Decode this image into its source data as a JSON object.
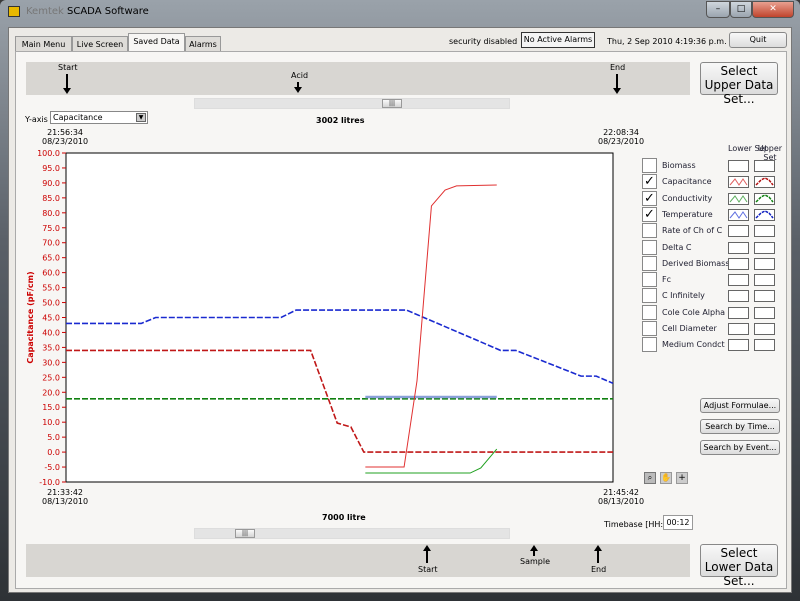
{
  "window": {
    "title": "SCADA Software",
    "title_blurred": "Kemtek",
    "minimize": "–",
    "maximize": "□",
    "close": "✕"
  },
  "tabs": [
    {
      "label": "Main Menu"
    },
    {
      "label": "Live Screen"
    },
    {
      "label": "Saved Data",
      "active": true
    },
    {
      "label": "Alarms"
    }
  ],
  "status": {
    "security": "security disabled",
    "alarms": "No Active Alarms",
    "datetime": "Thu, 2 Sep 2010  4:19:36 p.m.",
    "quit": "Quit"
  },
  "upper_events": {
    "markers": [
      {
        "label": "Start"
      },
      {
        "label": "Acid"
      },
      {
        "label": "End"
      }
    ],
    "select_button": "Select Upper Data Set..."
  },
  "lower_events": {
    "markers": [
      {
        "label": "Start"
      },
      {
        "label": "Sample"
      },
      {
        "label": "End"
      }
    ],
    "select_button": "Select Lower Data Set..."
  },
  "yaxis_select": {
    "label": "Y-axis",
    "value": "Capacitance"
  },
  "upper_title": "3002 litres",
  "lower_title": "7000 litre",
  "timebase": {
    "label": "Timebase [HH:MM]",
    "value": "00:12"
  },
  "buttons": {
    "adjust": "Adjust Formulae...",
    "search_time": "Search by Time...",
    "search_event": "Search by Event..."
  },
  "legend": {
    "lower_header": "Lower Set",
    "upper_header": "Upper Set",
    "items": [
      {
        "label": "Biomass",
        "checked": false
      },
      {
        "label": "Capacitance",
        "checked": true,
        "color_lower": "#e06060",
        "color_upper": "#b01010"
      },
      {
        "label": "Conductivity",
        "checked": true,
        "color_lower": "#60b060",
        "color_upper": "#108010"
      },
      {
        "label": "Temperature",
        "checked": true,
        "color_lower": "#6070e0",
        "color_upper": "#1020c0"
      },
      {
        "label": "Rate of Ch of C",
        "checked": false
      },
      {
        "label": "Delta C",
        "checked": false
      },
      {
        "label": "Derived Biomass",
        "checked": false
      },
      {
        "label": "Fc",
        "checked": false
      },
      {
        "label": "C Infinitely",
        "checked": false
      },
      {
        "label": "Cole Cole Alpha",
        "checked": false
      },
      {
        "label": "Cell Diameter",
        "checked": false
      },
      {
        "label": "Medium Condct",
        "checked": false
      }
    ]
  },
  "graph_tools": [
    "zoom-icon",
    "pan-hand-icon",
    "cursor-plus-icon"
  ],
  "chart_data": {
    "type": "line",
    "ylabel": "Capacitance (pF/cm)",
    "ylim": [
      -10,
      100
    ],
    "yticks": [
      "100.0",
      "95.0",
      "90.0",
      "85.0",
      "80.0",
      "75.0",
      "70.0",
      "65.0",
      "60.0",
      "55.0",
      "50.0",
      "45.0",
      "40.0",
      "35.0",
      "30.0",
      "25.0",
      "20.0",
      "15.0",
      "10.0",
      "5.0",
      "0.0",
      "-5.0",
      "-10.0"
    ],
    "upper_xaxis": {
      "start_time": "21:56:34",
      "start_date": "08/23/2010",
      "end_time": "22:08:34",
      "end_date": "08/23/2010"
    },
    "lower_xaxis": {
      "start_time": "21:33:42",
      "start_date": "08/13/2010",
      "end_time": "21:45:42",
      "end_date": "08/13/2010"
    },
    "grid": false,
    "series": [
      {
        "set": "upper",
        "name": "Temperature",
        "color": "#1a2ad0",
        "dashed": true,
        "x": [
          "21:56:34",
          "21:58:13",
          "21:58:32",
          "22:01:17",
          "22:01:37",
          "22:04:02",
          "22:06:06",
          "22:06:26",
          "22:07:52",
          "22:08:12",
          "22:08:34"
        ],
        "y": [
          43,
          43,
          45,
          45,
          47.5,
          47.5,
          34,
          34,
          25.4,
          25.4,
          23
        ]
      },
      {
        "set": "upper",
        "name": "Capacitance",
        "color": "#c01818",
        "dashed": true,
        "x": [
          "21:56:34",
          "22:01:56",
          "22:02:31",
          "22:02:49",
          "22:03:06",
          "22:08:34"
        ],
        "y": [
          34,
          34,
          9.7,
          8.4,
          0,
          0
        ]
      },
      {
        "set": "upper",
        "name": "Conductivity",
        "color": "#108010",
        "dashed": true,
        "x": [
          "21:56:34",
          "22:08:34"
        ],
        "y": [
          17.8,
          17.8
        ]
      },
      {
        "set": "lower",
        "name": "Temperature",
        "color": "#8aa0d8",
        "dashed": false,
        "x": [
          "21:40:16",
          "21:43:09"
        ],
        "y": [
          18.4,
          18.4
        ]
      },
      {
        "set": "lower",
        "name": "Capacitance",
        "color": "#e03030",
        "dashed": false,
        "x": [
          "21:40:16",
          "21:41:07",
          "21:41:24",
          "21:41:43",
          "21:42:01",
          "21:42:16",
          "21:43:09"
        ],
        "y": [
          -5,
          -5,
          23.8,
          82.3,
          87.6,
          89,
          89.3
        ]
      },
      {
        "set": "lower",
        "name": "Conductivity",
        "color": "#20a020",
        "dashed": false,
        "x": [
          "21:40:16",
          "21:42:34",
          "21:42:48",
          "21:43:09"
        ],
        "y": [
          -7,
          -7,
          -5.3,
          1.0
        ]
      }
    ]
  }
}
